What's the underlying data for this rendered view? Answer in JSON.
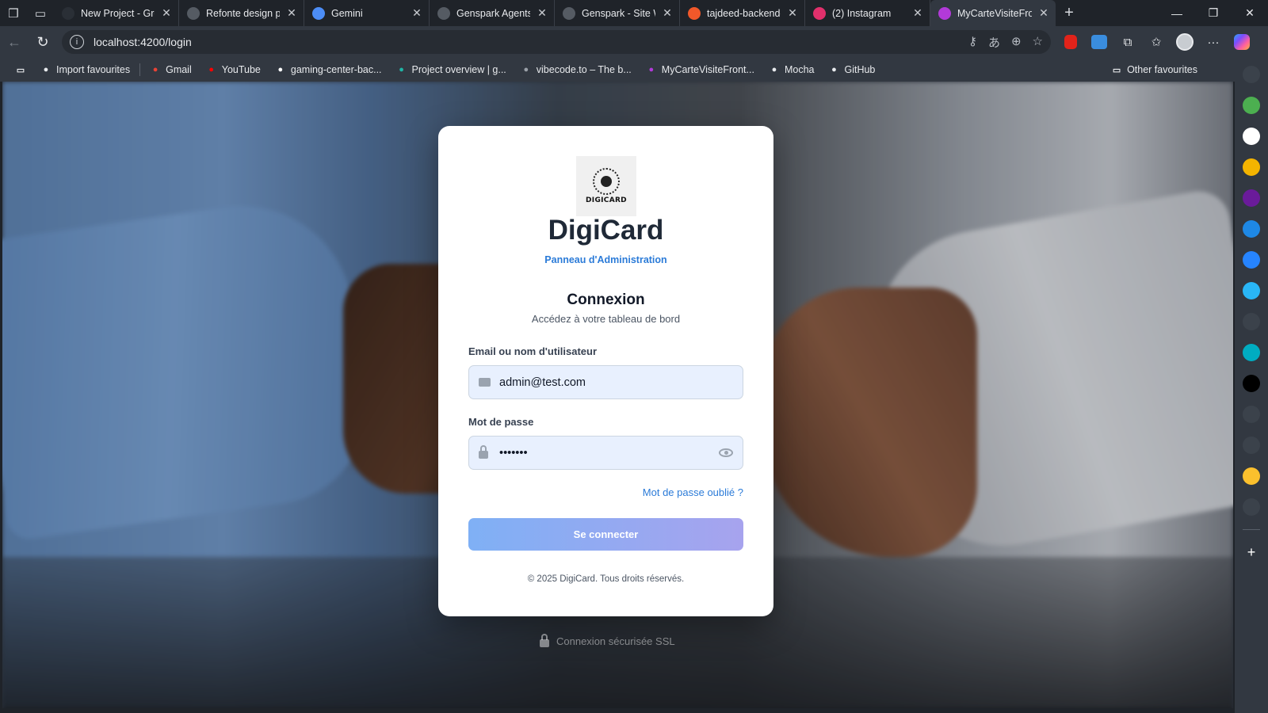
{
  "browser": {
    "tabs": [
      {
        "title": "New Project - Grok",
        "favicon": "grok-icon",
        "color": "#2a2f36"
      },
      {
        "title": "Refonte design pag",
        "favicon": "openai-icon",
        "color": "#555b63"
      },
      {
        "title": "Gemini",
        "favicon": "gemini-icon",
        "color": "#4c8df6"
      },
      {
        "title": "Genspark Agents",
        "favicon": "genspark-icon",
        "color": "#555b63"
      },
      {
        "title": "Genspark - Site We",
        "favicon": "genspark-icon",
        "color": "#555b63"
      },
      {
        "title": "tajdeed-backend-n",
        "favicon": "render-icon",
        "color": "#f1582a"
      },
      {
        "title": "(2) Instagram",
        "favicon": "instagram-icon",
        "color": "#e1306c"
      },
      {
        "title": "MyCarteVisiteFront",
        "favicon": "mycarte-icon",
        "color": "#b23ad9"
      }
    ],
    "url": "localhost:4200/login",
    "bookmarks": [
      {
        "label": "Import favourites",
        "icon": "import-icon",
        "color": "#e8eaed"
      },
      {
        "label": "Gmail",
        "icon": "gmail-icon",
        "color": "#ea4335"
      },
      {
        "label": "YouTube",
        "icon": "youtube-icon",
        "color": "#ff0000"
      },
      {
        "label": "gaming-center-bac...",
        "icon": "vercel-icon",
        "color": "#ffffff"
      },
      {
        "label": "Project overview | g...",
        "icon": "project-icon",
        "color": "#1fb5a6"
      },
      {
        "label": "vibecode.to – The b...",
        "icon": "vibecode-icon",
        "color": "#9aa0a8"
      },
      {
        "label": "MyCarteVisiteFront...",
        "icon": "mycarte-icon",
        "color": "#b23ad9"
      },
      {
        "label": "Mocha",
        "icon": "mocha-icon",
        "color": "#e8eaed"
      },
      {
        "label": "GitHub",
        "icon": "github-icon",
        "color": "#e8eaed"
      }
    ],
    "other_favourites": "Other favourites",
    "sidebar": [
      {
        "icon": "search-icon",
        "color": "#3b424b"
      },
      {
        "icon": "leaf-icon",
        "color": "#4caf50"
      },
      {
        "icon": "github-icon",
        "color": "#ffffff"
      },
      {
        "icon": "w-icon",
        "color": "#f4b400"
      },
      {
        "icon": "o-icon",
        "color": "#6a1b9a"
      },
      {
        "icon": "refresh-ext-icon",
        "color": "#1e88e5"
      },
      {
        "icon": "jira-icon",
        "color": "#2684ff"
      },
      {
        "icon": "chat-icon",
        "color": "#29b6f6"
      },
      {
        "icon": "globe-icon",
        "color": "#3b424b"
      },
      {
        "icon": "square-icon",
        "color": "#00acc1"
      },
      {
        "icon": "html-css-icon",
        "color": "#000000"
      },
      {
        "icon": "gear-ext-icon",
        "color": "#3b424b"
      },
      {
        "icon": "drop-icon",
        "color": "#3b424b"
      },
      {
        "icon": "medal-icon",
        "color": "#fbc02d"
      },
      {
        "icon": "infinity-icon",
        "color": "#3b424b"
      }
    ]
  },
  "login": {
    "brand": "DigiCard",
    "logo_text": "DIGICARD",
    "subtitle": "Panneau d'Administration",
    "heading": "Connexion",
    "subheading": "Accédez à votre tableau de bord",
    "email_label": "Email ou nom d'utilisateur",
    "email_value": "admin@test.com",
    "password_label": "Mot de passe",
    "password_value": "•••••••",
    "forgot_link": "Mot de passe oublié ?",
    "submit_label": "Se connecter",
    "footer": "© 2025 DigiCard. Tous droits réservés.",
    "secure_note": "Connexion sécurisée SSL",
    "accent_color": "#2b7bd8"
  }
}
